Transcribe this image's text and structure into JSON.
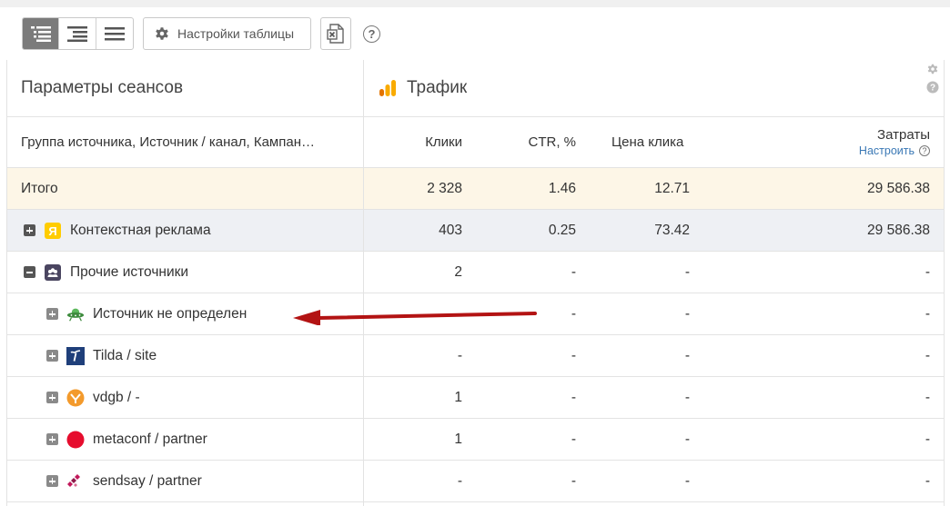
{
  "toolbar": {
    "view_buttons": [
      "tree-view",
      "right-tree-view",
      "flat-view"
    ],
    "settings_label": "Настройки таблицы",
    "help": "?"
  },
  "header": {
    "group_title": "Параметры сеансов",
    "traffic_title": "Трафик",
    "dimension_label": "Группа источника, Источник / канал, Кампан…",
    "columns": {
      "clicks": "Клики",
      "ctr": "CTR, %",
      "cpc": "Цена клика",
      "cost": "Затраты",
      "configure": "Настроить"
    }
  },
  "rows": [
    {
      "label": "Итого",
      "clicks": "2 328",
      "ctr": "1.46",
      "cpc": "12.71",
      "cost": "29 586.38"
    },
    {
      "label": "Контекстная реклама",
      "clicks": "403",
      "ctr": "0.25",
      "cpc": "73.42",
      "cost": "29 586.38",
      "icon": "yandex-icon"
    },
    {
      "label": "Прочие источники",
      "clicks": "2",
      "ctr": "-",
      "cpc": "-",
      "cost": "-",
      "icon": "people-icon"
    },
    {
      "label": "Источник не определен",
      "clicks": "",
      "ctr": "-",
      "cpc": "-",
      "cost": "-",
      "icon": "ufo-icon"
    },
    {
      "label": "Tilda / site",
      "clicks": "-",
      "ctr": "-",
      "cpc": "-",
      "cost": "-",
      "icon": "tilda-icon"
    },
    {
      "label": "vdgb / -",
      "clicks": "1",
      "ctr": "-",
      "cpc": "-",
      "cost": "-",
      "icon": "vdgb-icon"
    },
    {
      "label": "metaconf / partner",
      "clicks": "1",
      "ctr": "-",
      "cpc": "-",
      "cost": "-",
      "icon": "red-circle-icon"
    },
    {
      "label": "sendsay / partner",
      "clicks": "-",
      "ctr": "-",
      "cpc": "-",
      "cost": "-",
      "icon": "sendsay-icon"
    }
  ],
  "colors": {
    "total_bg": "#fdf6e7",
    "group_bg": "#eef0f4",
    "arrow": "#b31313",
    "link": "#3a78b5"
  }
}
